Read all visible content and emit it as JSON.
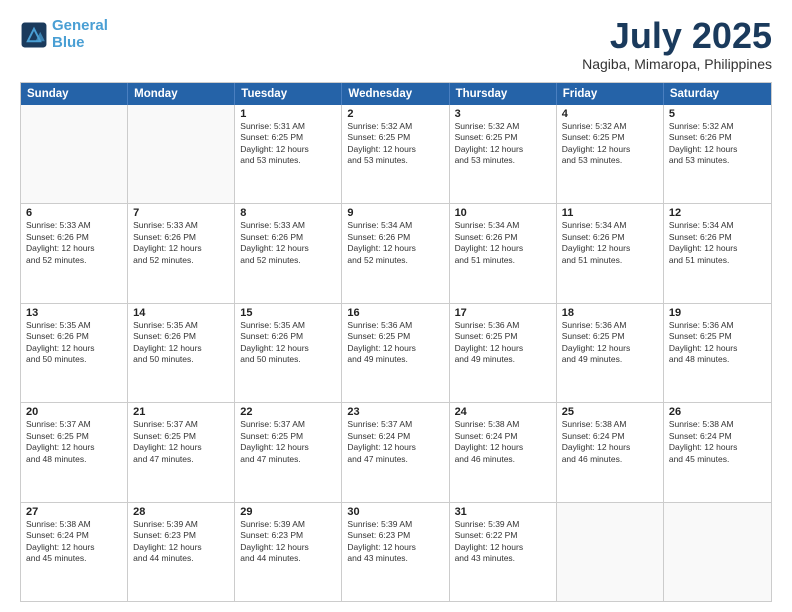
{
  "logo": {
    "line1": "General",
    "line2": "Blue"
  },
  "title": "July 2025",
  "subtitle": "Nagiba, Mimaropa, Philippines",
  "header_days": [
    "Sunday",
    "Monday",
    "Tuesday",
    "Wednesday",
    "Thursday",
    "Friday",
    "Saturday"
  ],
  "weeks": [
    [
      {
        "day": "",
        "info": ""
      },
      {
        "day": "",
        "info": ""
      },
      {
        "day": "1",
        "info": "Sunrise: 5:31 AM\nSunset: 6:25 PM\nDaylight: 12 hours\nand 53 minutes."
      },
      {
        "day": "2",
        "info": "Sunrise: 5:32 AM\nSunset: 6:25 PM\nDaylight: 12 hours\nand 53 minutes."
      },
      {
        "day": "3",
        "info": "Sunrise: 5:32 AM\nSunset: 6:25 PM\nDaylight: 12 hours\nand 53 minutes."
      },
      {
        "day": "4",
        "info": "Sunrise: 5:32 AM\nSunset: 6:25 PM\nDaylight: 12 hours\nand 53 minutes."
      },
      {
        "day": "5",
        "info": "Sunrise: 5:32 AM\nSunset: 6:26 PM\nDaylight: 12 hours\nand 53 minutes."
      }
    ],
    [
      {
        "day": "6",
        "info": "Sunrise: 5:33 AM\nSunset: 6:26 PM\nDaylight: 12 hours\nand 52 minutes."
      },
      {
        "day": "7",
        "info": "Sunrise: 5:33 AM\nSunset: 6:26 PM\nDaylight: 12 hours\nand 52 minutes."
      },
      {
        "day": "8",
        "info": "Sunrise: 5:33 AM\nSunset: 6:26 PM\nDaylight: 12 hours\nand 52 minutes."
      },
      {
        "day": "9",
        "info": "Sunrise: 5:34 AM\nSunset: 6:26 PM\nDaylight: 12 hours\nand 52 minutes."
      },
      {
        "day": "10",
        "info": "Sunrise: 5:34 AM\nSunset: 6:26 PM\nDaylight: 12 hours\nand 51 minutes."
      },
      {
        "day": "11",
        "info": "Sunrise: 5:34 AM\nSunset: 6:26 PM\nDaylight: 12 hours\nand 51 minutes."
      },
      {
        "day": "12",
        "info": "Sunrise: 5:34 AM\nSunset: 6:26 PM\nDaylight: 12 hours\nand 51 minutes."
      }
    ],
    [
      {
        "day": "13",
        "info": "Sunrise: 5:35 AM\nSunset: 6:26 PM\nDaylight: 12 hours\nand 50 minutes."
      },
      {
        "day": "14",
        "info": "Sunrise: 5:35 AM\nSunset: 6:26 PM\nDaylight: 12 hours\nand 50 minutes."
      },
      {
        "day": "15",
        "info": "Sunrise: 5:35 AM\nSunset: 6:26 PM\nDaylight: 12 hours\nand 50 minutes."
      },
      {
        "day": "16",
        "info": "Sunrise: 5:36 AM\nSunset: 6:25 PM\nDaylight: 12 hours\nand 49 minutes."
      },
      {
        "day": "17",
        "info": "Sunrise: 5:36 AM\nSunset: 6:25 PM\nDaylight: 12 hours\nand 49 minutes."
      },
      {
        "day": "18",
        "info": "Sunrise: 5:36 AM\nSunset: 6:25 PM\nDaylight: 12 hours\nand 49 minutes."
      },
      {
        "day": "19",
        "info": "Sunrise: 5:36 AM\nSunset: 6:25 PM\nDaylight: 12 hours\nand 48 minutes."
      }
    ],
    [
      {
        "day": "20",
        "info": "Sunrise: 5:37 AM\nSunset: 6:25 PM\nDaylight: 12 hours\nand 48 minutes."
      },
      {
        "day": "21",
        "info": "Sunrise: 5:37 AM\nSunset: 6:25 PM\nDaylight: 12 hours\nand 47 minutes."
      },
      {
        "day": "22",
        "info": "Sunrise: 5:37 AM\nSunset: 6:25 PM\nDaylight: 12 hours\nand 47 minutes."
      },
      {
        "day": "23",
        "info": "Sunrise: 5:37 AM\nSunset: 6:24 PM\nDaylight: 12 hours\nand 47 minutes."
      },
      {
        "day": "24",
        "info": "Sunrise: 5:38 AM\nSunset: 6:24 PM\nDaylight: 12 hours\nand 46 minutes."
      },
      {
        "day": "25",
        "info": "Sunrise: 5:38 AM\nSunset: 6:24 PM\nDaylight: 12 hours\nand 46 minutes."
      },
      {
        "day": "26",
        "info": "Sunrise: 5:38 AM\nSunset: 6:24 PM\nDaylight: 12 hours\nand 45 minutes."
      }
    ],
    [
      {
        "day": "27",
        "info": "Sunrise: 5:38 AM\nSunset: 6:24 PM\nDaylight: 12 hours\nand 45 minutes."
      },
      {
        "day": "28",
        "info": "Sunrise: 5:39 AM\nSunset: 6:23 PM\nDaylight: 12 hours\nand 44 minutes."
      },
      {
        "day": "29",
        "info": "Sunrise: 5:39 AM\nSunset: 6:23 PM\nDaylight: 12 hours\nand 44 minutes."
      },
      {
        "day": "30",
        "info": "Sunrise: 5:39 AM\nSunset: 6:23 PM\nDaylight: 12 hours\nand 43 minutes."
      },
      {
        "day": "31",
        "info": "Sunrise: 5:39 AM\nSunset: 6:22 PM\nDaylight: 12 hours\nand 43 minutes."
      },
      {
        "day": "",
        "info": ""
      },
      {
        "day": "",
        "info": ""
      }
    ]
  ]
}
